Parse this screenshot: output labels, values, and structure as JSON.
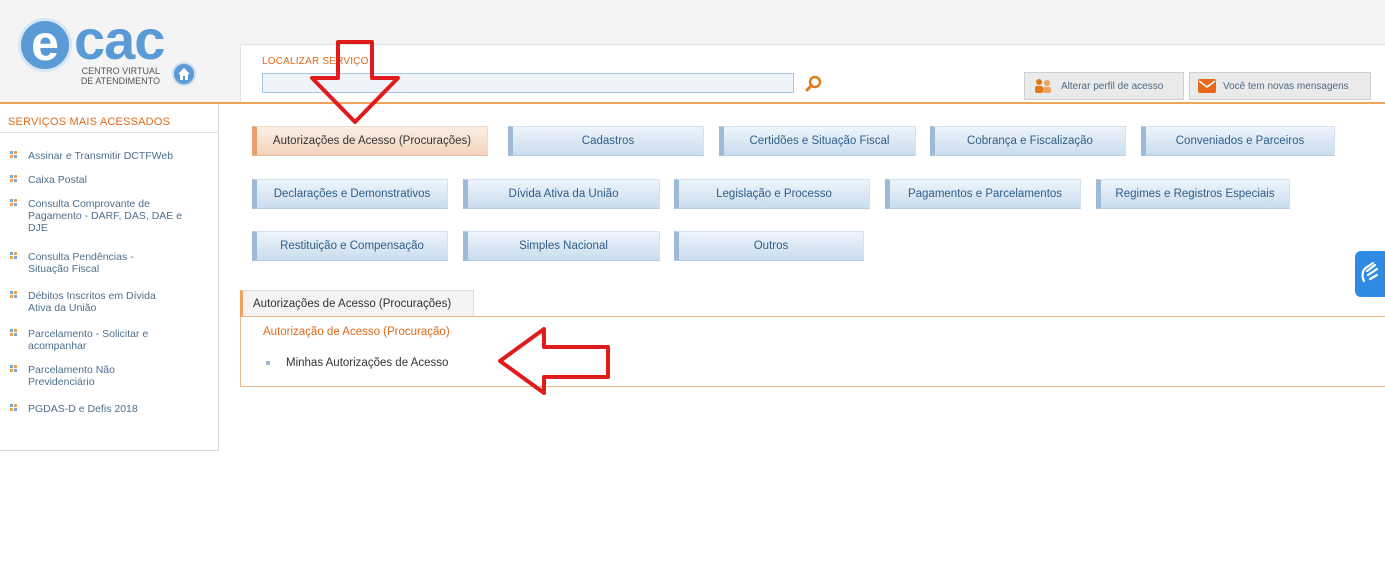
{
  "logo": {
    "e_letter": "e",
    "name": "cac",
    "sub_line1": "CENTRO VIRTUAL",
    "sub_line2": "DE ATENDIMENTO"
  },
  "header": {
    "search_label": "LOCALIZAR SERVIÇO",
    "search_value": "",
    "profile_button": "Alterar perfil de acesso",
    "messages_button": "Você tem novas mensagens"
  },
  "sidebar": {
    "title": "SERVIÇOS MAIS ACESSADOS",
    "items": [
      "Assinar e Transmitir DCTFWeb",
      "Caixa Postal",
      "Consulta Comprovante de Pagamento - DARF, DAS, DAE e DJE",
      "Consulta Pendências - Situação Fiscal",
      "Débitos Inscritos em Dívida Ativa da União",
      "Parcelamento - Solicitar e acompanhar",
      "Parcelamento Não Previdenciário",
      "PGDAS-D e Defis 2018"
    ]
  },
  "categories": [
    "Autorizações de Acesso (Procurações)",
    "Cadastros",
    "Certidões e Situação Fiscal",
    "Cobrança e Fiscalização",
    "Conveniados e Parceiros",
    "Declarações e Demonstrativos",
    "Dívida Ativa da União",
    "Legislação e Processo",
    "Pagamentos e Parcelamentos",
    "Regimes e Registros Especiais",
    "Restituição e Compensação",
    "Simples Nacional",
    "Outros"
  ],
  "panel": {
    "tab": "Autorizações de Acesso (Procurações)",
    "section_title": "Autorização de Acesso (Procuração)",
    "link": "Minhas Autorizações de Acesso"
  },
  "colors": {
    "accent_orange": "#e06a1b",
    "brand_blue": "#5a9ad6",
    "annotation_red": "#e01b1b"
  }
}
